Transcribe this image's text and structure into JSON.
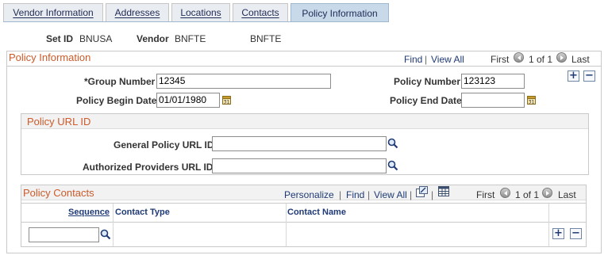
{
  "tabs": [
    {
      "label": "Vendor Information",
      "active": false
    },
    {
      "label": "Addresses",
      "active": false
    },
    {
      "label": "Locations",
      "active": false
    },
    {
      "label": "Contacts",
      "active": false
    },
    {
      "label": "Policy Information",
      "active": true
    }
  ],
  "header": {
    "setid_label": "Set ID",
    "setid_value": "BNUSA",
    "vendor_label": "Vendor",
    "vendor_value": "BNFTE",
    "vendor_name": "BNFTE"
  },
  "policy": {
    "title": "Policy Information",
    "nav": {
      "find": "Find",
      "view_all": "View All",
      "first": "First",
      "range": "1 of 1",
      "last": "Last"
    },
    "group_number_label": "*Group Number",
    "group_number_value": "12345",
    "policy_number_label": "Policy Number",
    "policy_number_value": "123123",
    "begin_date_label": "Policy Begin Date",
    "begin_date_value": "01/01/1980",
    "end_date_label": "Policy End Date",
    "end_date_value": ""
  },
  "url": {
    "title": "Policy URL ID",
    "general_label": "General Policy URL ID",
    "general_value": "",
    "authorized_label": "Authorized Providers URL ID",
    "authorized_value": ""
  },
  "contacts": {
    "title": "Policy Contacts",
    "nav": {
      "personalize": "Personalize",
      "find": "Find",
      "view_all": "View All",
      "first": "First",
      "range": "1 of 1",
      "last": "Last"
    },
    "columns": [
      "Sequence",
      "Contact Type",
      "Contact Name"
    ],
    "row": {
      "sequence": "",
      "contact_type": "",
      "contact_name": ""
    }
  },
  "buttons": {
    "add": "+",
    "delete": "−"
  },
  "colors": {
    "section_title": "#cc5a2a",
    "link": "#1f3a75",
    "active_tab": "#c8d9ea"
  }
}
